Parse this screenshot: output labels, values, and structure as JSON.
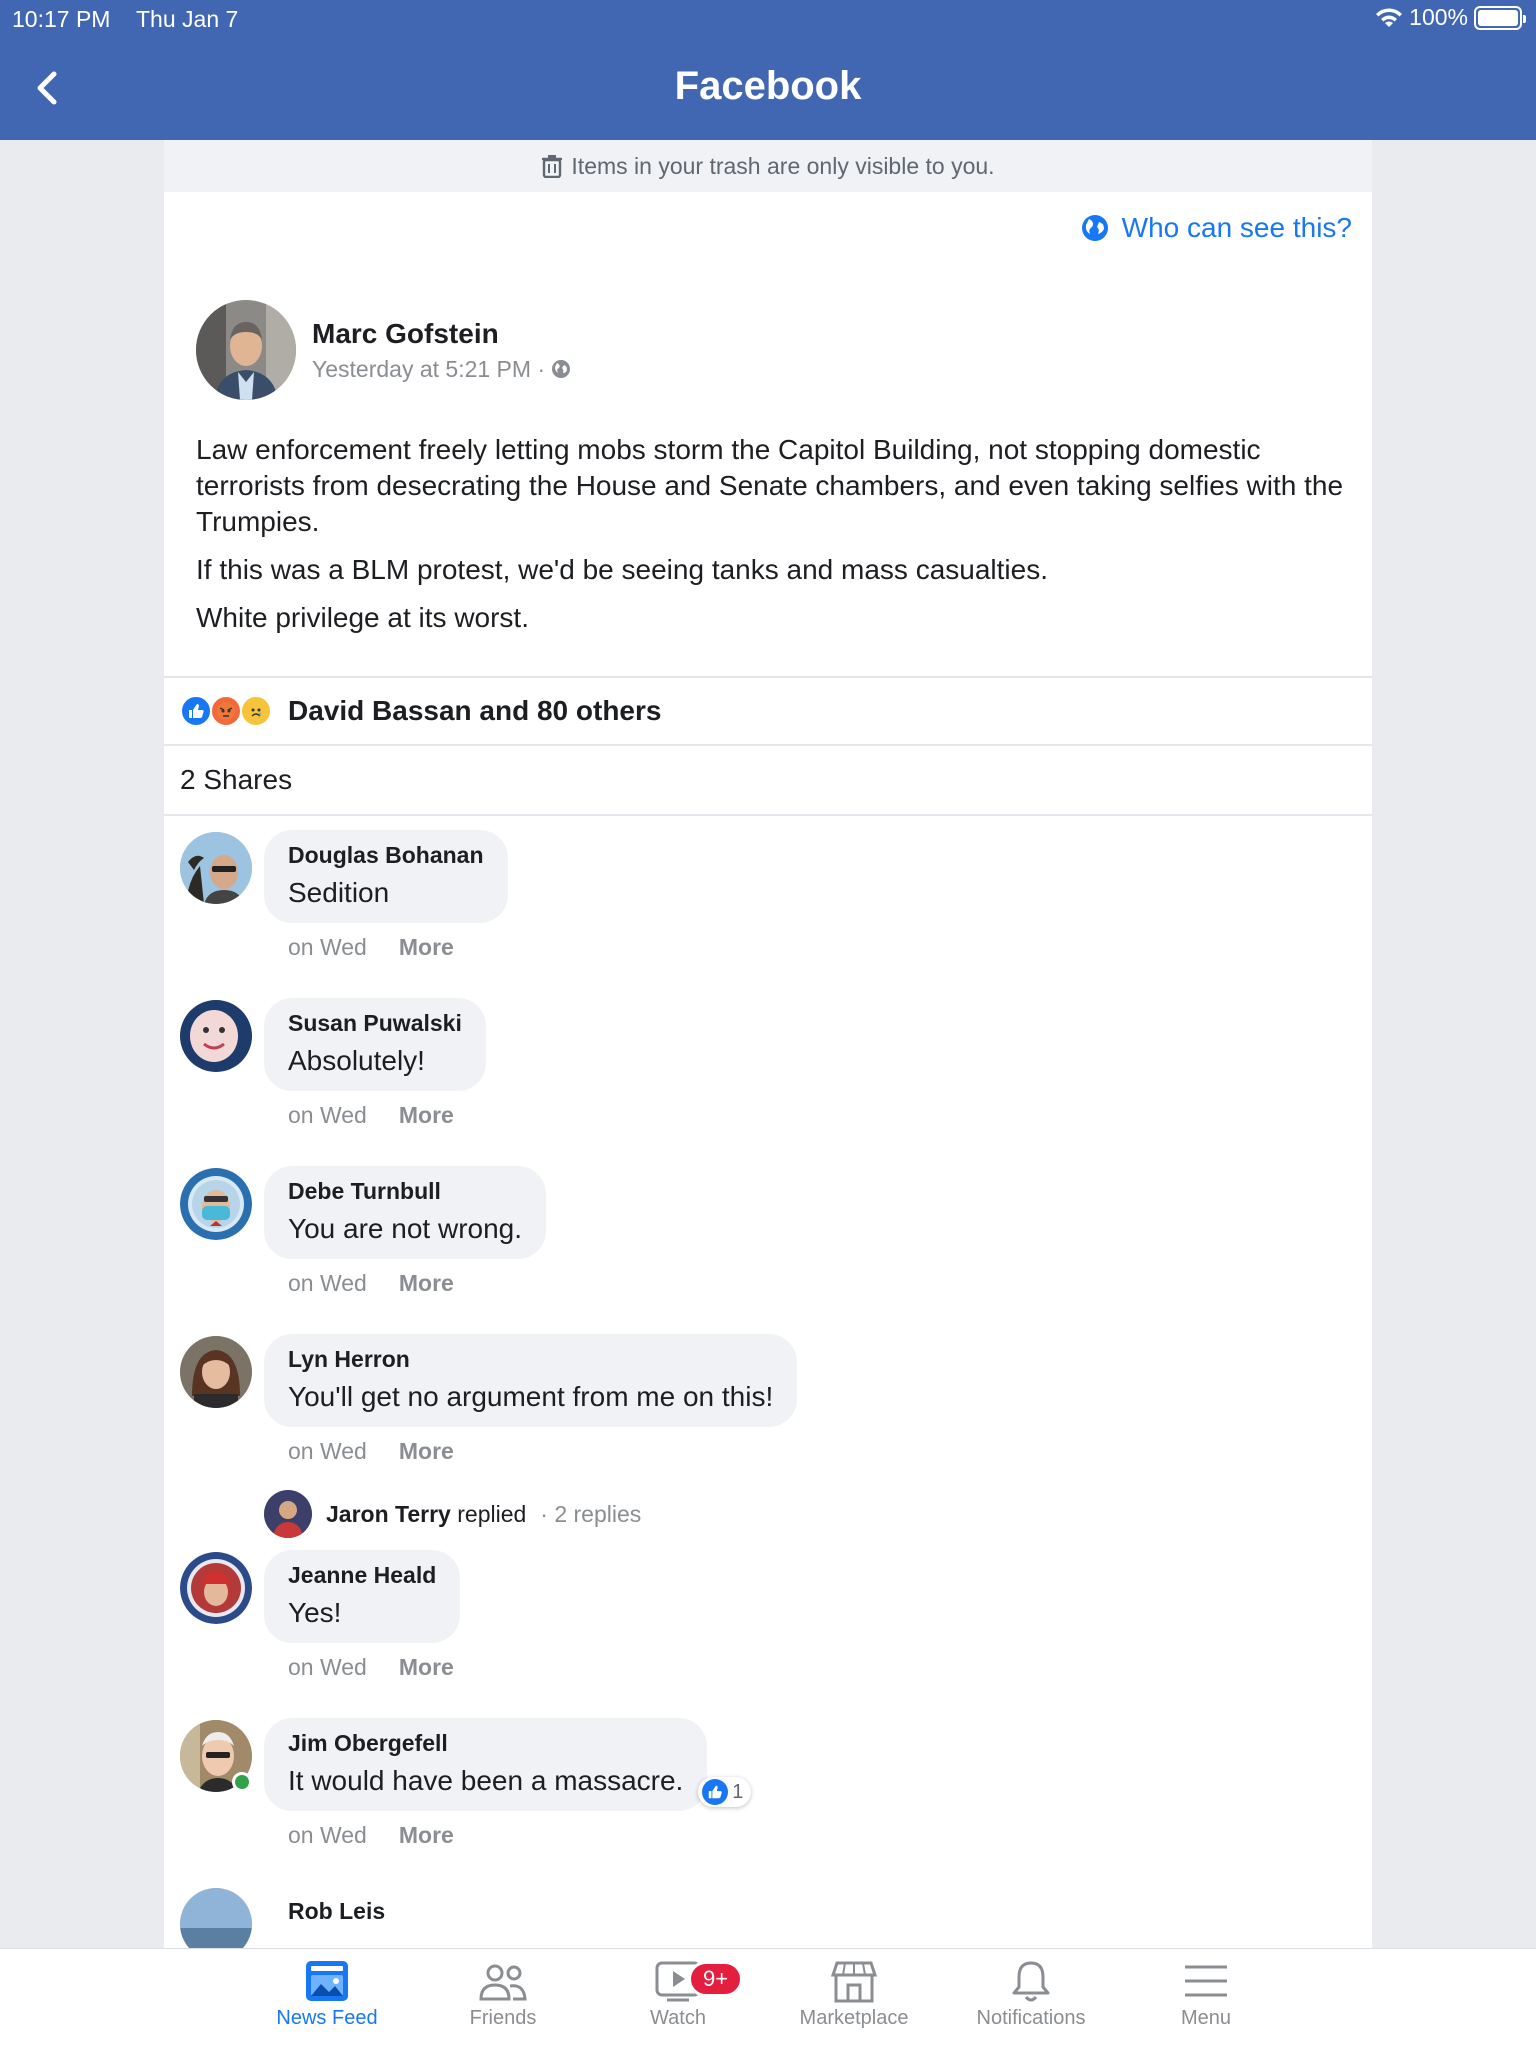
{
  "status_bar": {
    "time": "10:17 PM",
    "date": "Thu Jan 7",
    "battery": "100%"
  },
  "header": {
    "title": "Facebook"
  },
  "trash_notice": "Items in your trash are only visible to you.",
  "who_can_see": "Who can see this?",
  "post": {
    "author": "Marc Gofstein",
    "timestamp": "Yesterday at 5:21 PM ·",
    "paragraphs": [
      "Law enforcement freely letting mobs storm the Capitol Building, not stopping domestic terrorists from desecrating the House and Senate chambers, and even taking selfies with the Trumpies.",
      "If this was a BLM protest, we'd be seeing tanks and mass casualties.",
      "White privilege at its worst."
    ]
  },
  "reactions": {
    "summary": "David Bassan and 80 others",
    "icons": [
      "like-reaction-icon",
      "angry-reaction-icon",
      "sad-reaction-icon"
    ]
  },
  "shares": "2 Shares",
  "comments": [
    {
      "name": "Douglas Bohanan",
      "text": "Sedition",
      "time": "on Wed",
      "more": "More"
    },
    {
      "name": "Susan Puwalski",
      "text": "Absolutely!",
      "time": "on Wed",
      "more": "More"
    },
    {
      "name": "Debe Turnbull",
      "text": "You are not wrong.",
      "time": "on Wed",
      "more": "More"
    },
    {
      "name": "Lyn Herron",
      "text": "You'll get no argument from me on this!",
      "time": "on Wed",
      "more": "More"
    },
    {
      "name": "Jeanne Heald",
      "text": "Yes!",
      "time": "on Wed",
      "more": "More"
    },
    {
      "name": "Jim Obergefell",
      "text": "It would have been a massacre.",
      "time": "on Wed",
      "more": "More",
      "likes": "1"
    },
    {
      "name": "Rob Leis"
    }
  ],
  "reply_summary": {
    "name": "Jaron Terry",
    "verb": "replied",
    "count": "· 2 replies"
  },
  "tabs": [
    {
      "label": "News Feed",
      "icon": "news-feed-icon",
      "active": true
    },
    {
      "label": "Friends",
      "icon": "friends-icon"
    },
    {
      "label": "Watch",
      "icon": "watch-icon",
      "badge": "9+"
    },
    {
      "label": "Marketplace",
      "icon": "marketplace-icon"
    },
    {
      "label": "Notifications",
      "icon": "bell-icon"
    },
    {
      "label": "Menu",
      "icon": "menu-icon"
    }
  ],
  "colors": {
    "header": "#4267b2",
    "link": "#1877f2",
    "bubble": "#f0f2f5",
    "badge": "#e41e3f"
  }
}
